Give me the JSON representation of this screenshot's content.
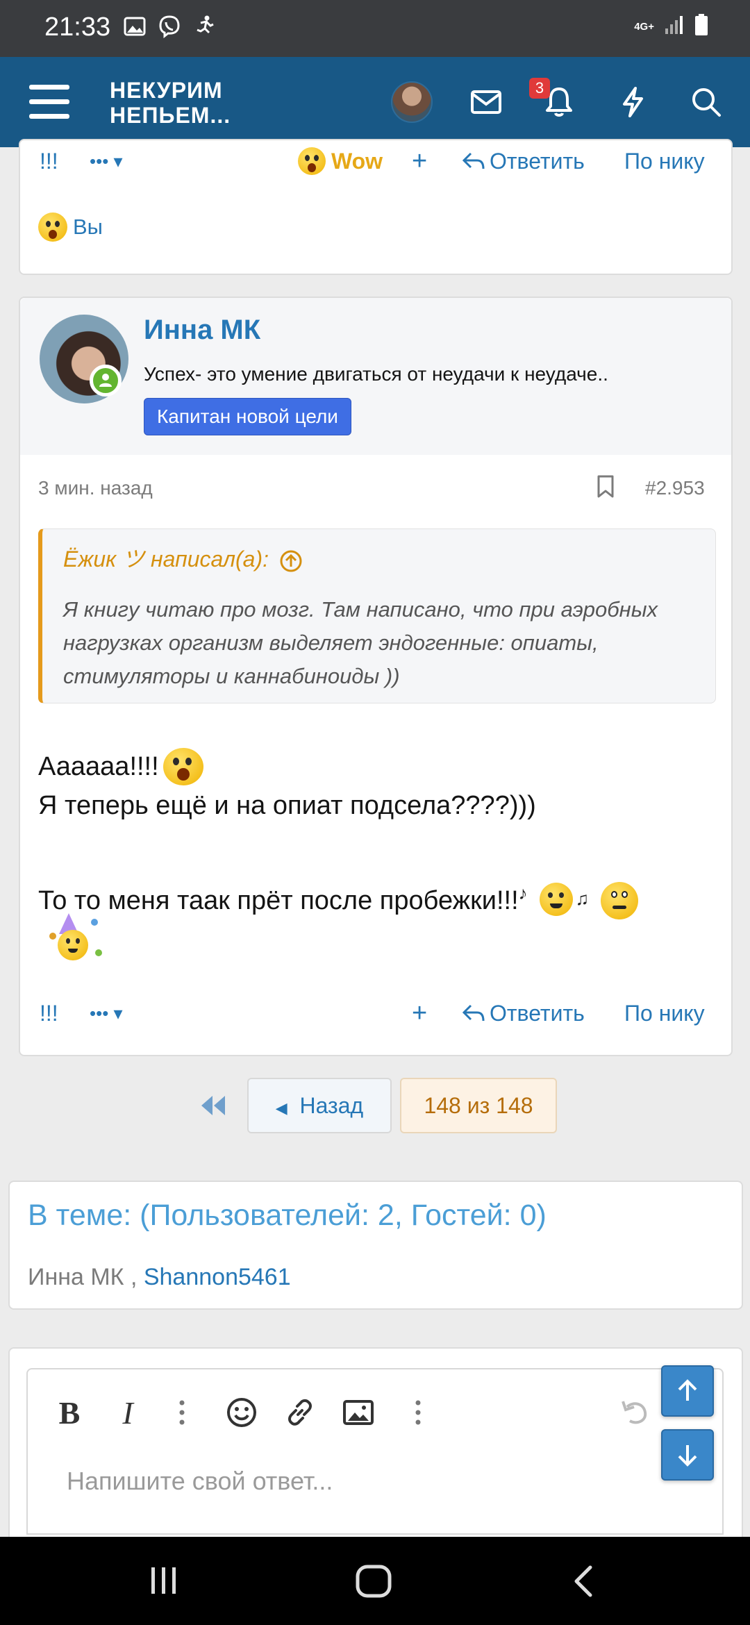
{
  "status_bar": {
    "time": "21:33",
    "network": "4G+"
  },
  "header": {
    "logo_line1": "НЕКУРИМ",
    "logo_line2": "НЕПЬЕМ...",
    "alerts_count": "3"
  },
  "prev_post": {
    "actions": {
      "report": "!!!",
      "more": "•••",
      "reaction": "Wow",
      "add": "+",
      "reply": "Ответить",
      "by_nick": "По нику"
    },
    "reacted_by": "Вы"
  },
  "post": {
    "author_name": "Инна МК",
    "author_status": "Успех- это умение двигаться от неудачи к неудаче..",
    "author_badge": "Капитан новой цели",
    "time": "3 мин. назад",
    "post_number": "#2.953",
    "quote": {
      "author": "Ёжик ツ написал(а):",
      "text": "Я книгу читаю про мозг. Там написано, что при аэробных нагрузках организм выделяет эндогенные: опиаты, стимуляторы и каннабиноиды ))"
    },
    "message_line1": "Аааааа!!!!",
    "message_line2": "Я теперь ещё и на опиат подсела????)))",
    "message_line3": "То то меня таак прёт после пробежки!!!",
    "actions": {
      "report": "!!!",
      "more": "•••",
      "add": "+",
      "reply": "Ответить",
      "by_nick": "По нику"
    }
  },
  "pagination": {
    "back_label": "Назад",
    "page_status": "148 из 148"
  },
  "online": {
    "title": "В теме: (Пользователей: 2, Гостей: 0)",
    "user1": "Инна МК",
    "separator": ",",
    "user2": "Shannon5461"
  },
  "editor": {
    "placeholder": "Напишите свой ответ..."
  },
  "colors": {
    "header_bg": "#185886",
    "link": "#2677b6",
    "badge": "#3f6ee4",
    "quote_accent": "#e59a1c",
    "alert_badge": "#e03a3a",
    "fab": "#3a87c9"
  }
}
